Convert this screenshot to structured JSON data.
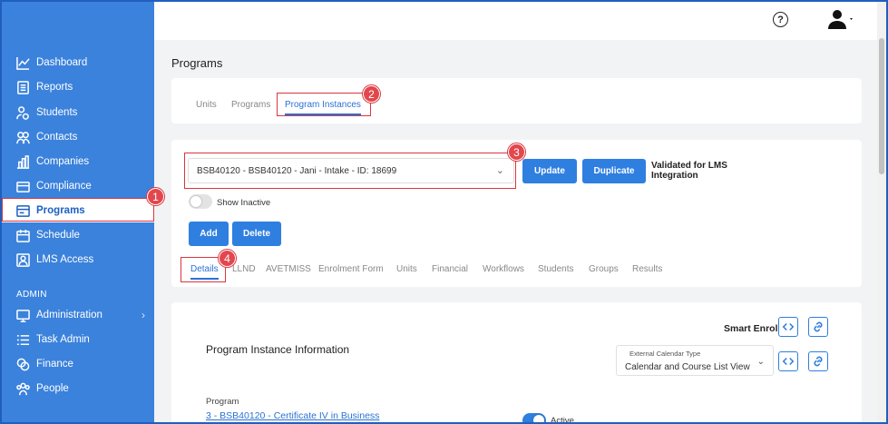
{
  "sidebar": {
    "items": [
      {
        "label": "Dashboard",
        "icon": "chart-line-icon"
      },
      {
        "label": "Reports",
        "icon": "reports-icon"
      },
      {
        "label": "Students",
        "icon": "students-icon"
      },
      {
        "label": "Contacts",
        "icon": "contacts-icon"
      },
      {
        "label": "Companies",
        "icon": "companies-icon"
      },
      {
        "label": "Compliance",
        "icon": "compliance-icon"
      },
      {
        "label": "Programs",
        "icon": "programs-icon",
        "active": true
      },
      {
        "label": "Schedule",
        "icon": "schedule-icon"
      },
      {
        "label": "LMS Access",
        "icon": "lms-access-icon"
      }
    ],
    "admin_heading": "ADMIN",
    "admin_items": [
      {
        "label": "Administration",
        "icon": "administration-icon",
        "has_submenu": true
      },
      {
        "label": "Task Admin",
        "icon": "task-admin-icon"
      },
      {
        "label": "Finance",
        "icon": "finance-icon"
      },
      {
        "label": "People",
        "icon": "people-icon"
      }
    ]
  },
  "topbar": {
    "help_glyph": "?",
    "icons": [
      "help-icon",
      "user-icon"
    ]
  },
  "page": {
    "title": "Programs"
  },
  "top_tabs": [
    {
      "label": "Units"
    },
    {
      "label": "Programs"
    },
    {
      "label": "Program Instances",
      "active": true
    }
  ],
  "instance": {
    "selected": "BSB40120 - BSB40120 - Jani - Intake - ID: 18699",
    "update_label": "Update",
    "duplicate_label": "Duplicate",
    "validated_text": "Validated for LMS Integration",
    "show_inactive_label": "Show Inactive",
    "add_label": "Add",
    "delete_label": "Delete"
  },
  "sub_tabs": [
    {
      "label": "Details",
      "active": true
    },
    {
      "label": "LLND"
    },
    {
      "label": "AVETMISS"
    },
    {
      "label": "Enrolment Form"
    },
    {
      "label": "Units"
    },
    {
      "label": "Financial"
    },
    {
      "label": "Workflows"
    },
    {
      "label": "Students"
    },
    {
      "label": "Groups"
    },
    {
      "label": "Results"
    }
  ],
  "details": {
    "smart_enrol_label": "Smart Enrol",
    "section_title": "Program Instance Information",
    "external_calendar_label": "External Calendar Type",
    "external_calendar_value": "Calendar and Course List View",
    "program_label": "Program",
    "program_value": "3 - BSB40120 - Certificate IV in Business",
    "active_label": "Active"
  },
  "annotations": [
    "1",
    "2",
    "3",
    "4"
  ],
  "colors": {
    "sidebar": "#3b82dc",
    "accent": "#2f7fe0",
    "annotation": "#d9363e"
  }
}
